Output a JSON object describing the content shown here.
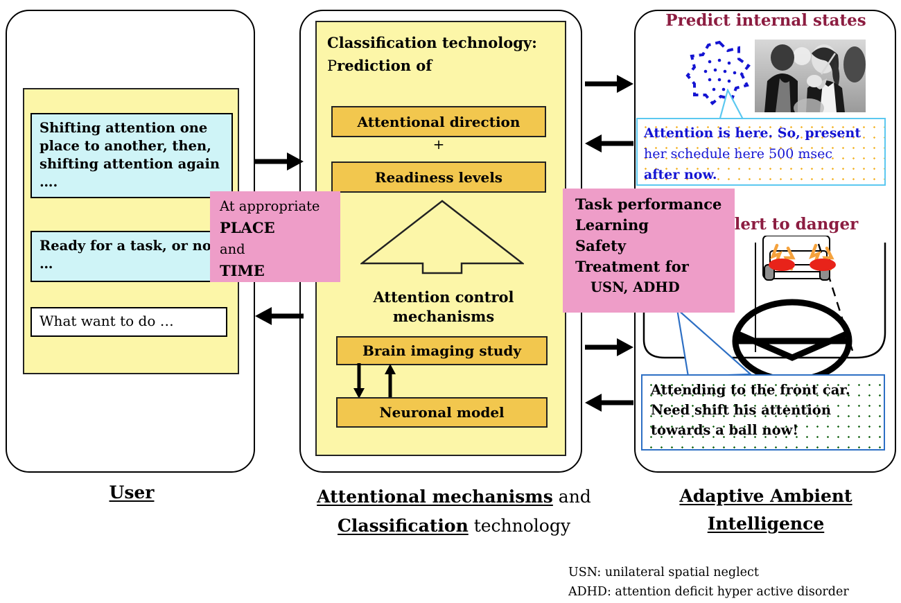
{
  "left_column": {
    "caption": "User",
    "items": [
      {
        "text": "Shifting attention one place to another, then, shifting attention again ….",
        "style": "cyan"
      },
      {
        "text": "Ready for a task, or not …",
        "style": "cyan"
      },
      {
        "text": "What want to do …",
        "style": "white"
      }
    ]
  },
  "middle_column": {
    "caption_line1_underlined": "Attentional mechanisms",
    "caption_line1_plain": " and",
    "caption_line2_underlined": "Classification",
    "caption_line2_plain": " technology",
    "title_line1": "Classification technology:",
    "title_line2_cap": "P",
    "title_line2_rest": "rediction of",
    "box_attentional_direction": "Attentional direction",
    "plus_sign": "+",
    "box_readiness_levels": "Readiness levels",
    "attention_control_line1": "Attention control",
    "attention_control_line2": "mechanisms",
    "box_brain_imaging": "Brain imaging study",
    "box_neuronal_model": "Neuronal model"
  },
  "right_column": {
    "caption_line1": "Adaptive Ambient",
    "caption_line2": "Intelligence",
    "section_predict_title": "Predict internal states",
    "section_alert_title": "Alert to danger",
    "bubble_predict": {
      "line1": "Attention is here. So, present",
      "line2": "her schedule here 500 msec",
      "line3": "after now."
    },
    "bubble_alert": {
      "line1": "Attending to the front car.",
      "line2": "Need shift his attention",
      "line3": "towards a ball now!"
    }
  },
  "overlays": {
    "place_time": {
      "line1": "At appropriate",
      "line2": "PLACE",
      "line3": "and",
      "line4": "TIME"
    },
    "outcomes": {
      "line1": "Task performance",
      "line2": "Learning",
      "line3": "Safety",
      "line4": "Treatment for",
      "line5": "USN, ADHD"
    }
  },
  "legend": {
    "line1": "USN: unilateral spatial neglect",
    "line2": "ADHD: attention deficit hyper active disorder"
  },
  "colors": {
    "pale_yellow": "#FCF6A8",
    "orange": "#F2C74E",
    "cyan": "#CFF4F7",
    "pink": "#EE9DC8",
    "maroon": "#8C1D41",
    "blue_text": "#1414D2",
    "bubble1_border": "#5BC8F0",
    "bubble2_border": "#2D6FC4"
  }
}
